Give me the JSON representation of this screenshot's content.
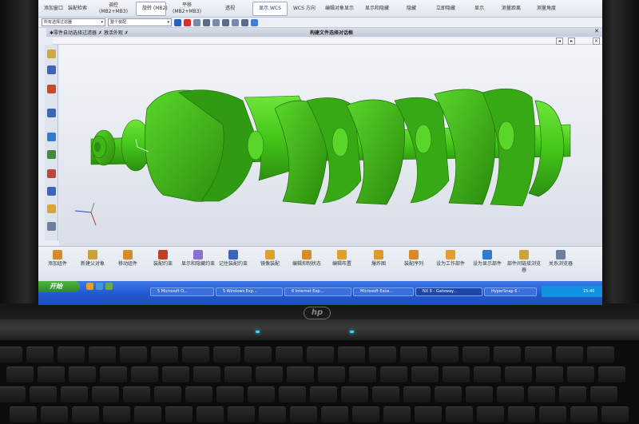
{
  "ribbon": {
    "items": [
      "添加窗口",
      "装配检索",
      "调控\n(MB2+MB3)",
      "旋转 (MB2)",
      "平移\n(MB2+MB3)",
      "透视",
      "显示 WCS",
      "WCS 方向",
      "编辑对象显示",
      "显示和隐藏",
      "隐藏",
      "立即隐藏",
      "显示",
      "测量距离",
      "测量角度"
    ]
  },
  "toolbar": {
    "filter_value": "所有选择过滤器",
    "assembly_value": "整个装配"
  },
  "window": {
    "left_text": "✱零件自动选择过滤器 ✗ 激活外观 ✗",
    "title": "构建文件选择对话框",
    "close": "✕"
  },
  "bottombar": {
    "items": [
      "添加组件",
      "新建父对象",
      "移动组件",
      "装配约束",
      "显示和隐藏约束",
      "记住装配约束",
      "镜像装配",
      "编辑抑制状态",
      "编辑布置",
      "爆炸图",
      "装配序列",
      "设为工作部件",
      "设为显示部件",
      "部件间链接浏览器",
      "关系浏览器"
    ]
  },
  "taskbar": {
    "start": "开始",
    "tasks": [
      "5 Microsoft O...",
      "5 Windows Exp...",
      "6 Internet Exp...",
      "Microsoft Exce...",
      "NX 6 - Gateway...",
      "HyperSnap 6 -"
    ],
    "clock": "15:40"
  },
  "brand": {
    "logo": "hp"
  },
  "colors": {
    "model": "#44c71a",
    "taskbar": "#2458d0",
    "start": "#3a9d30",
    "viewport": "#e6eaf0"
  }
}
